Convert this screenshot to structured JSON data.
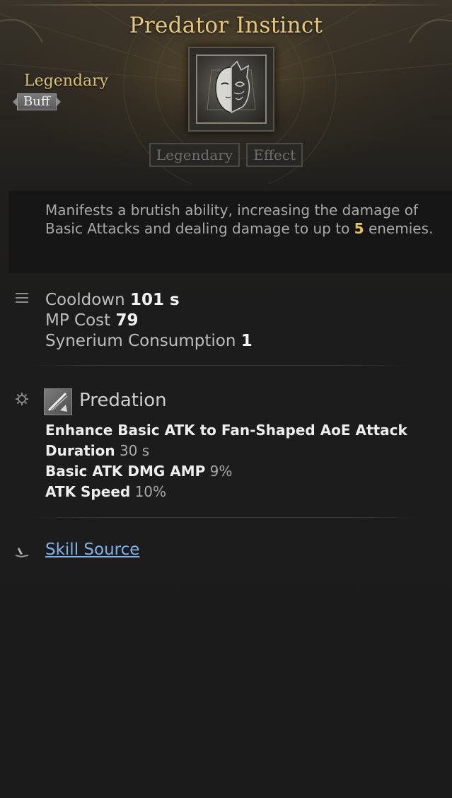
{
  "skill": {
    "name": "Predator Instinct",
    "grade": "Legendary",
    "type_tag": "Buff",
    "tags": [
      "Legendary",
      "Effect"
    ],
    "description": {
      "before": "Manifests a brutish ability, increasing the damage of Basic Attacks and dealing damage to up to ",
      "highlight": "5",
      "after": " enemies."
    },
    "icon": "half-face-mask-cat-icon"
  },
  "stats": {
    "cooldown_label": "Cooldown",
    "cooldown_value": "101 s",
    "mp_label": "MP Cost",
    "mp_value": "79",
    "synerium_label": "Synerium Consumption",
    "synerium_value": "1"
  },
  "effect": {
    "name": "Predation",
    "icon": "crossed-swords-effect-icon",
    "lines": [
      {
        "label": "Enhance Basic ATK to Fan-Shaped AoE Attack",
        "value": ""
      },
      {
        "label": "Duration",
        "value": "30 s"
      },
      {
        "label": "Basic ATK DMG AMP",
        "value": "9%"
      },
      {
        "label": "ATK Speed",
        "value": "10%"
      }
    ]
  },
  "source": {
    "link_label": "Skill Source"
  },
  "colors": {
    "title": "#e6c77a",
    "grade": "#d9c27a",
    "highlight": "#e8c34d",
    "link": "#7fb2ea"
  }
}
